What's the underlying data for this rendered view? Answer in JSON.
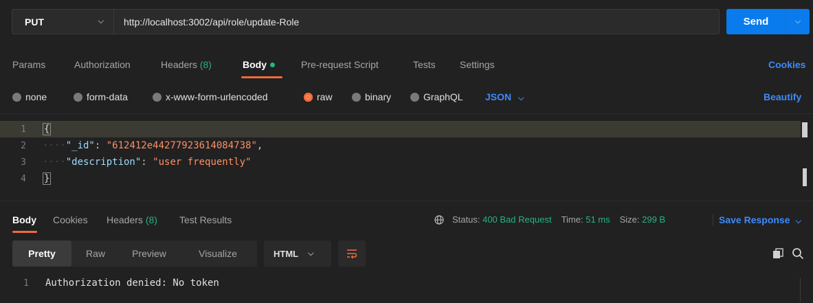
{
  "request": {
    "method": "PUT",
    "url": "http://localhost:3002/api/role/update-Role",
    "send_label": "Send"
  },
  "request_tabs": {
    "params": "Params",
    "authorization": "Authorization",
    "headers": "Headers",
    "headers_count": "(8)",
    "body": "Body",
    "prerequest": "Pre-request Script",
    "tests": "Tests",
    "settings": "Settings",
    "cookies": "Cookies"
  },
  "body_types": {
    "none": "none",
    "form_data": "form-data",
    "urlencoded": "x-www-form-urlencoded",
    "raw": "raw",
    "binary": "binary",
    "graphql": "GraphQL",
    "selected": "raw",
    "language": "JSON",
    "beautify": "Beautify"
  },
  "editor": {
    "lines": [
      {
        "n": "1",
        "open": "{"
      },
      {
        "n": "2",
        "key": "\"_id\"",
        "value": "\"612412e44277923614084738\"",
        "trail": ","
      },
      {
        "n": "3",
        "key": "\"description\"",
        "value": "\"user frequently\"",
        "trail": ""
      },
      {
        "n": "4",
        "close": "}"
      }
    ]
  },
  "response_tabs": {
    "body": "Body",
    "cookies": "Cookies",
    "headers": "Headers",
    "headers_count": "(8)",
    "test_results": "Test Results"
  },
  "status": {
    "status_label": "Status:",
    "status_value": "400 Bad Request",
    "time_label": "Time:",
    "time_value": "51 ms",
    "size_label": "Size:",
    "size_value": "299 B",
    "save_response": "Save Response"
  },
  "response_view": {
    "pretty": "Pretty",
    "raw": "Raw",
    "preview": "Preview",
    "visualize": "Visualize",
    "format": "HTML"
  },
  "response_body": {
    "lines": [
      {
        "n": "1",
        "text": "Authorization denied: No token"
      }
    ]
  },
  "colors": {
    "accent": "#f26b3a",
    "send": "#097bed",
    "link": "#3d8bfd",
    "success": "#26b47f"
  }
}
